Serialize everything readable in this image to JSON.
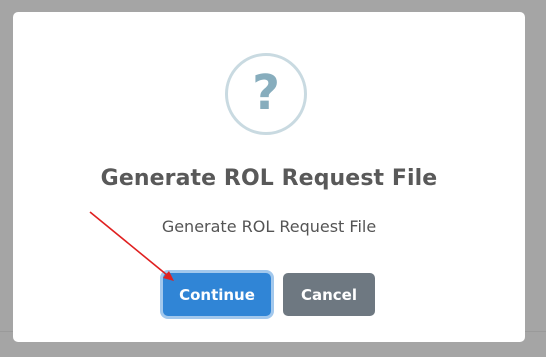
{
  "dialog": {
    "icon": "question-icon",
    "icon_text": "?",
    "title": "Generate ROL Request File",
    "message": "Generate ROL Request File",
    "confirm_label": "Continue",
    "cancel_label": "Cancel"
  },
  "colors": {
    "overlay": "#a5a5a5",
    "modal": "#ffffff",
    "icon_ring": "#c9dae1",
    "icon_mark": "#87adbd",
    "confirm": "#3085d6",
    "cancel": "#6e7881",
    "annotation_arrow": "#e02020"
  }
}
